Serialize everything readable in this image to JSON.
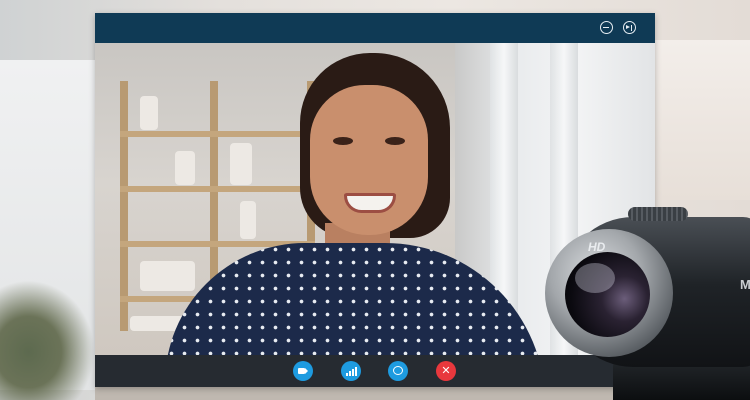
{
  "window": {
    "title": "",
    "titlebar_color": "#0f3a55",
    "buttons": {
      "minimize_icon": "minimize-circle-icon",
      "expand_icon": "fullscreen-toggle-icon"
    }
  },
  "controls": {
    "bar_color": "#262b31",
    "accent": "#1e9be0",
    "end_color": "#e8383d",
    "items": [
      {
        "name": "video-camera-button",
        "icon": "video-camera-icon"
      },
      {
        "name": "signal-stats-button",
        "icon": "signal-bars-icon"
      },
      {
        "name": "chat-button",
        "icon": "chat-bubble-icon"
      },
      {
        "name": "end-call-button",
        "icon": "close-x-icon",
        "glyph": "✕"
      }
    ]
  },
  "webcam": {
    "badge": "HD",
    "brand_fragment": "M"
  }
}
